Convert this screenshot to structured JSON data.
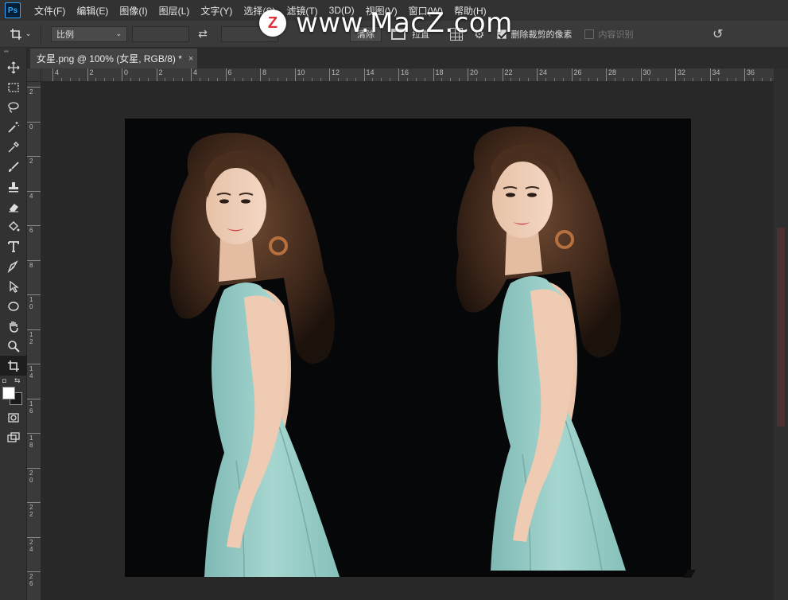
{
  "app": {
    "logo": "Ps",
    "menus": [
      "文件(F)",
      "编辑(E)",
      "图像(I)",
      "图层(L)",
      "文字(Y)",
      "选择(S)",
      "滤镜(T)",
      "3D(D)",
      "视图(V)",
      "窗口(W)",
      "帮助(H)"
    ]
  },
  "options": {
    "tool_icon": "crop-icon",
    "ratio_value": "比例",
    "clear_label": "清除",
    "straighten_label": "拉直",
    "delete_cropped_label": "删除裁剪的像素",
    "delete_cropped_checked": true,
    "content_aware_label": "内容识别",
    "content_aware_checked": false
  },
  "watermark": {
    "logo": "Z",
    "text": "www.MacZ.com"
  },
  "document": {
    "tab_title": "女星.png @ 100% (女星, RGB/8) *",
    "close": "×"
  },
  "rulers": {
    "horizontal": [
      "4",
      "2",
      "0",
      "2",
      "4",
      "6",
      "8",
      "10",
      "12",
      "14",
      "16",
      "18",
      "20",
      "22",
      "24",
      "26",
      "28",
      "30",
      "32",
      "34",
      "36"
    ],
    "vertical": [
      "2",
      "0",
      "2",
      "4",
      "6",
      "8",
      "10",
      "12",
      "14",
      "16",
      "18",
      "20",
      "22",
      "24",
      "26"
    ]
  },
  "colors": {
    "foreground": "#ffffff",
    "background": "#1a1a1a",
    "dress": "#9fcfca",
    "canvas": "#060708"
  }
}
